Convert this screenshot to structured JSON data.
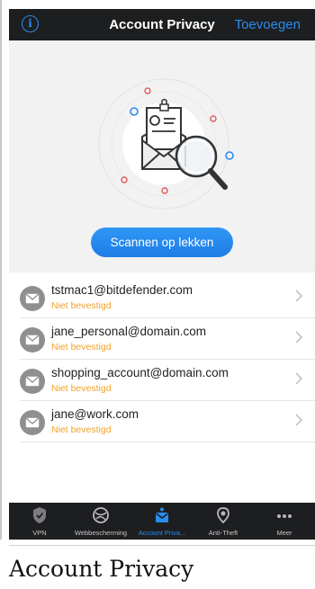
{
  "header": {
    "title": "Account Privacy",
    "add_label": "Toevoegen",
    "info_icon": "info-icon"
  },
  "hero": {
    "scan_button": "Scannen op lekken",
    "illustration": "email-magnifier-illustration"
  },
  "accounts": [
    {
      "email": "tstmac1@bitdefender.com",
      "status": "Niet bevestigd"
    },
    {
      "email": "jane_personal@domain.com",
      "status": "Niet bevestigd"
    },
    {
      "email": "shopping_account@domain.com",
      "status": "Niet bevestigd"
    },
    {
      "email": "jane@work.com",
      "status": "Niet bevestigd"
    }
  ],
  "tabs": [
    {
      "label": "VPN",
      "icon": "shield-icon"
    },
    {
      "label": "Webbescherming",
      "icon": "globe-icon"
    },
    {
      "label": "Account Priva...",
      "icon": "account-privacy-icon",
      "active": true
    },
    {
      "label": "Anti-Theft",
      "icon": "location-pin-icon"
    },
    {
      "label": "Meer",
      "icon": "more-dots-icon"
    }
  ],
  "caption": "Account Privacy",
  "colors": {
    "accent": "#2a8cf0",
    "warning": "#f2a22a",
    "bar": "#1d1e20"
  }
}
